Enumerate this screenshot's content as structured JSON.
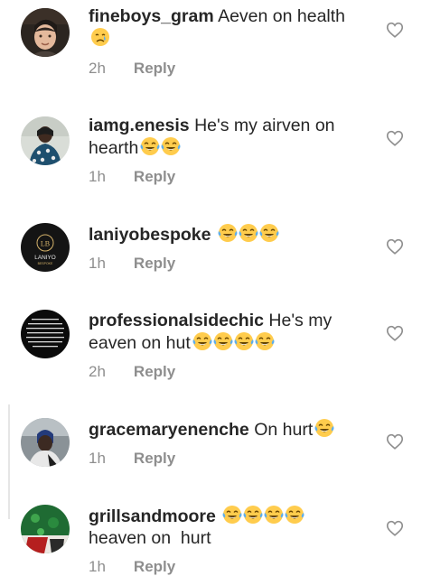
{
  "comments": [
    {
      "username": "fineboys_gram",
      "text": "Aeven on health",
      "emoji": [
        "crying-face"
      ],
      "time": "2h",
      "reply": "Reply"
    },
    {
      "username": "iamg.enesis",
      "text": "He's my airven on hearth",
      "emoji": [
        "laughing-tears",
        "laughing-tears"
      ],
      "time": "1h",
      "reply": "Reply"
    },
    {
      "username": "laniyobespoke",
      "text": "",
      "emoji": [
        "laughing-tears",
        "laughing-tears",
        "laughing-tears"
      ],
      "avatar_text": {
        "monogram": "LB",
        "name": "LANIYO",
        "tagline": "BESPOKE"
      },
      "time": "1h",
      "reply": "Reply"
    },
    {
      "username": "professionalsidechic",
      "text": "He's my eaven on hut",
      "emoji": [
        "laughing-tears",
        "laughing-tears",
        "laughing-tears",
        "laughing-tears"
      ],
      "time": "2h",
      "reply": "Reply"
    },
    {
      "username": "gracemaryenenche",
      "text": "On hurt",
      "emoji": [
        "laughing-tears"
      ],
      "time": "1h",
      "reply": "Reply"
    },
    {
      "username": "grillsandmoore",
      "text": "heaven on  hurt",
      "emoji": [
        "laughing-tears",
        "laughing-tears",
        "laughing-tears",
        "laughing-tears"
      ],
      "time": "1h",
      "reply": "Reply"
    }
  ],
  "icons": {
    "like": "heart-outline-icon",
    "laugh": "face-with-tears-of-joy-icon",
    "cry": "crying-face-icon"
  },
  "colors": {
    "text": "#262626",
    "secondary": "#8e8e8e",
    "heart_outline": "#8e8e8e",
    "emoji_face": "#ffcc4d"
  }
}
